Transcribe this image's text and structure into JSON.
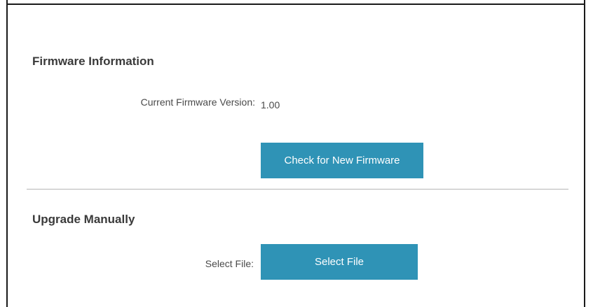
{
  "firmware_info": {
    "title": "Firmware Information",
    "current_version_label": "Current Firmware Version:",
    "current_version_value": "1.00",
    "check_button_label": "Check for New Firmware"
  },
  "upgrade_manual": {
    "title": "Upgrade Manually",
    "select_file_label": "Select File:",
    "select_file_button_label": "Select File"
  },
  "colors": {
    "button_bg": "#2f93b6",
    "button_text": "#ffffff",
    "heading_text": "#3a3a3a",
    "label_text": "#4a4a4a",
    "divider": "#b5b5b5"
  }
}
